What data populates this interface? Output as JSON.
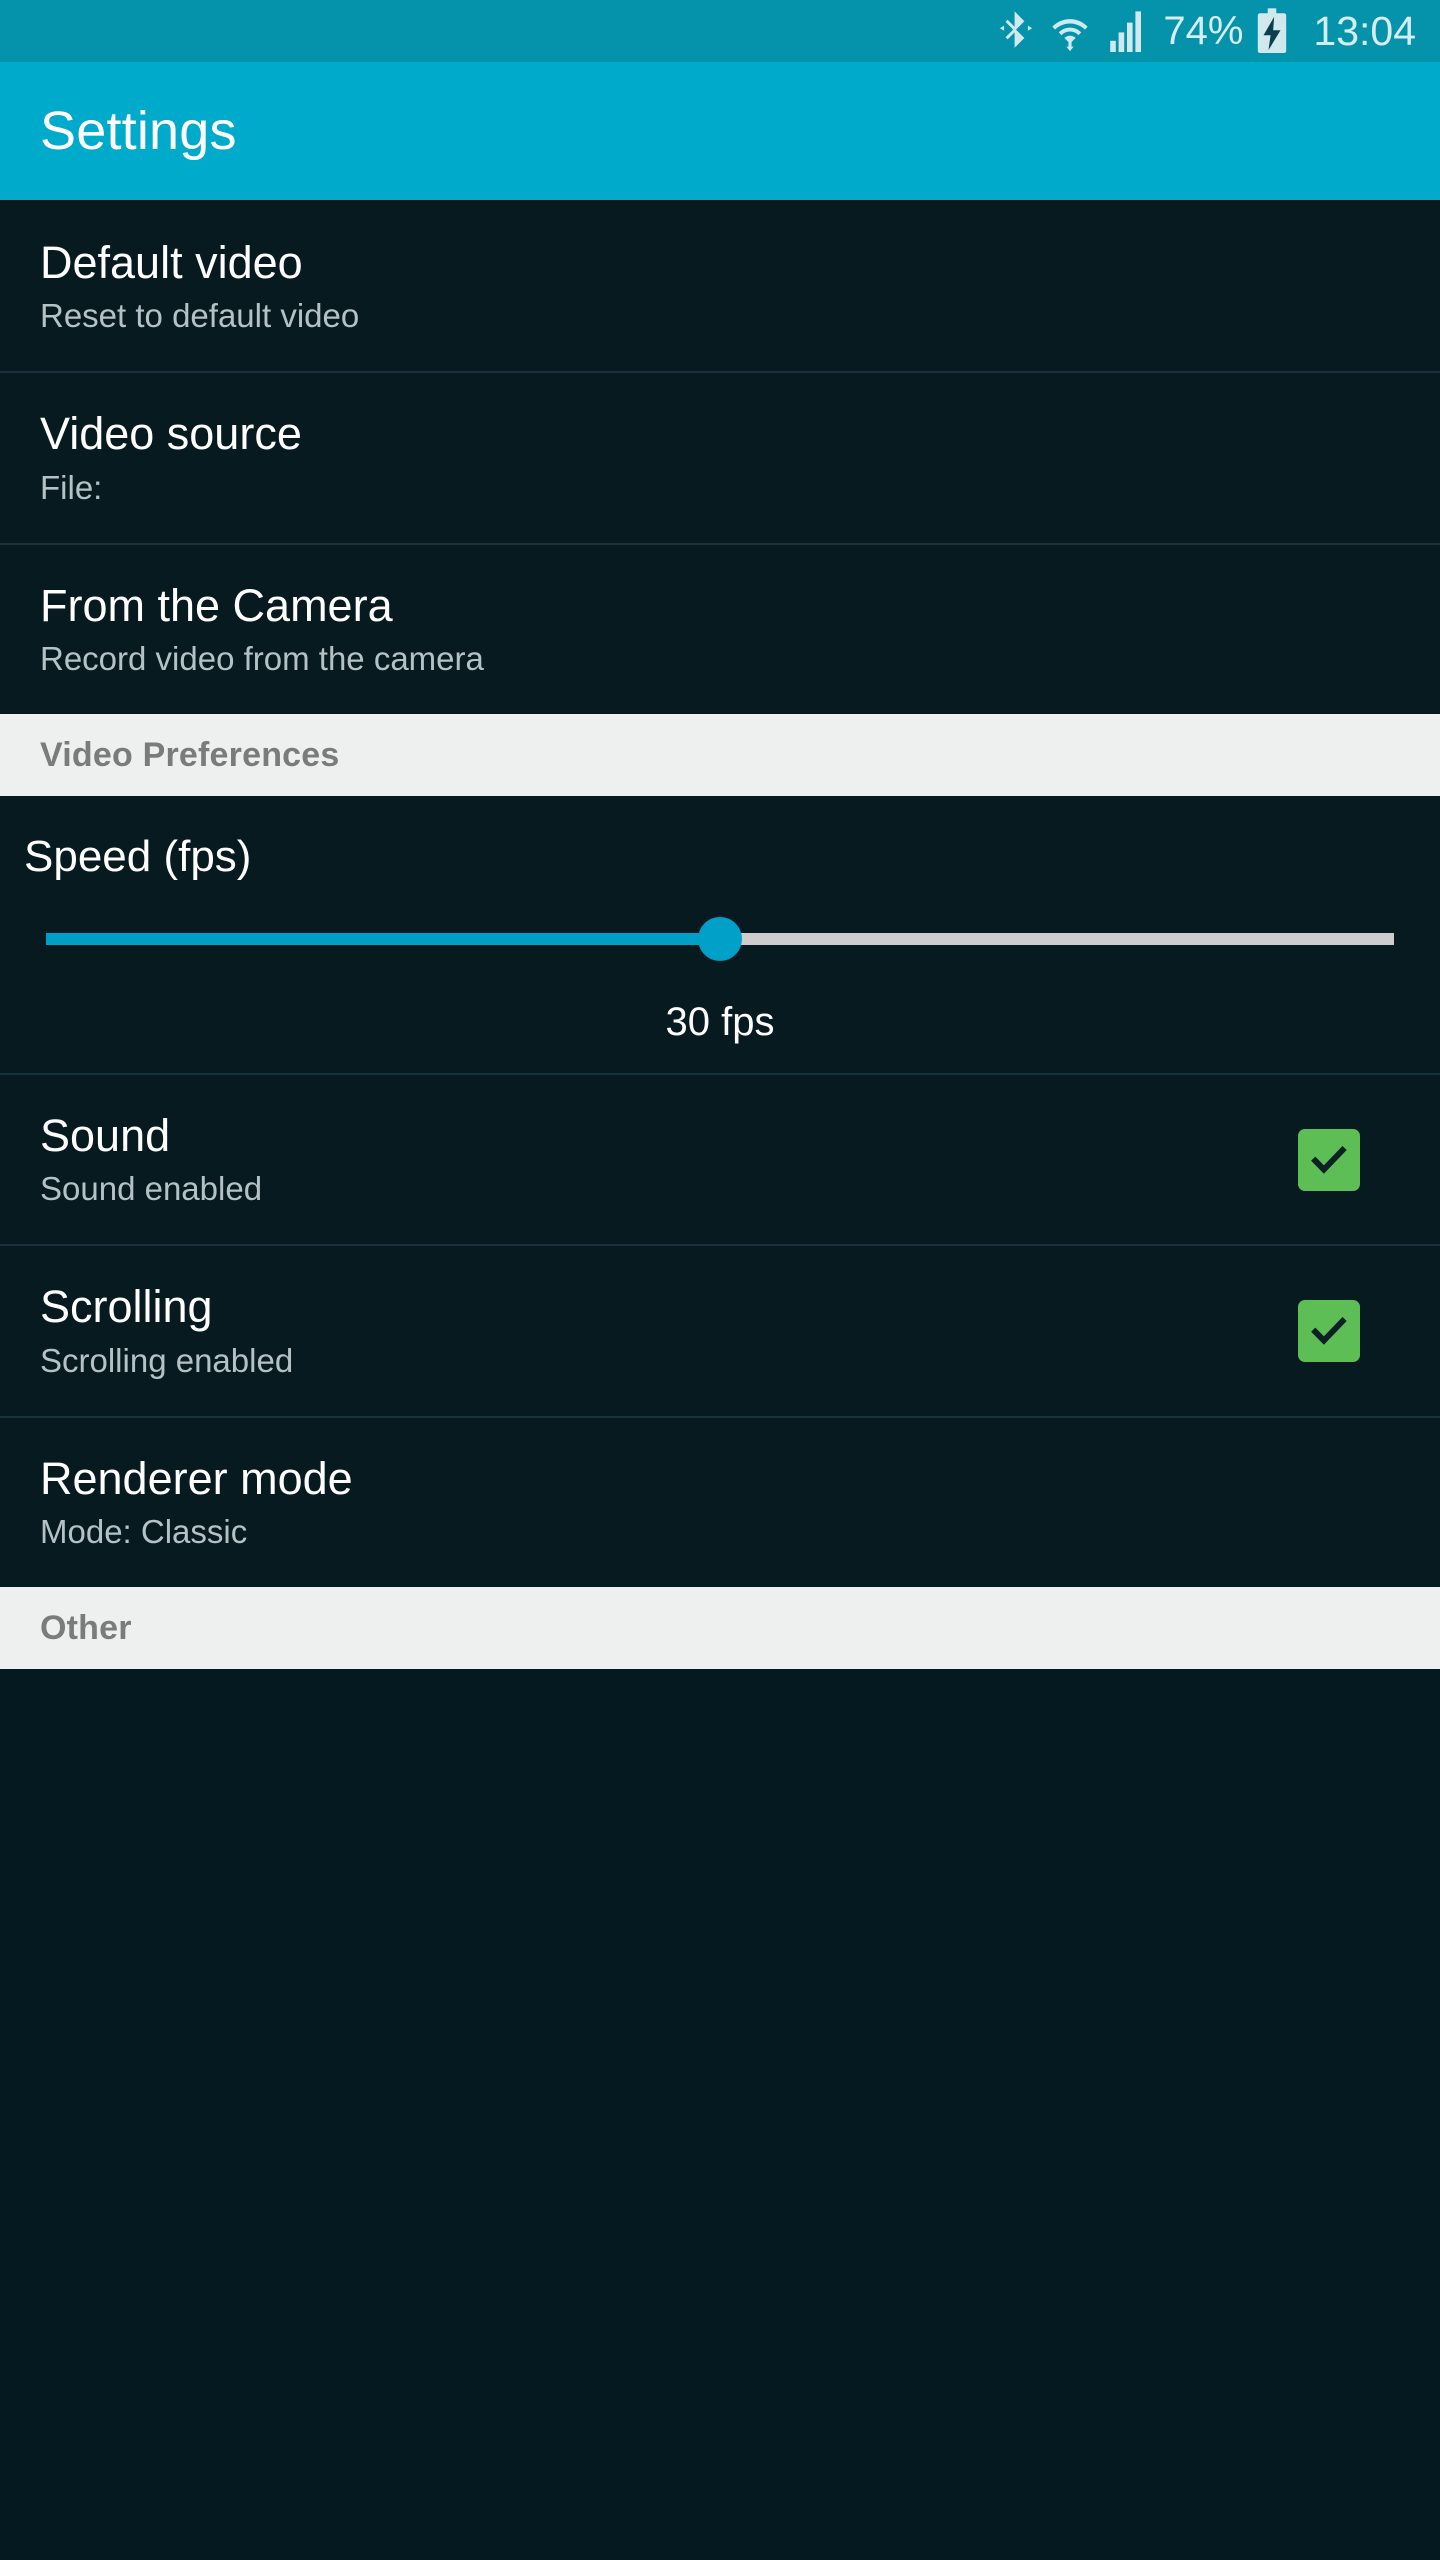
{
  "statusbar": {
    "icons": [
      "bluetooth-icon",
      "wifi-icon",
      "cellular-signal-icon",
      "battery-charging-icon"
    ],
    "battery_percent": "74%",
    "clock": "13:04",
    "background_color": "#0593ab",
    "foreground_color": "#d6eef2"
  },
  "actionbar": {
    "title": "Settings",
    "background_color": "#00aaca",
    "title_color": "#ffffff"
  },
  "theme": {
    "list_background": "#061a20",
    "divider": "#16323a",
    "primary_text": "#ffffff",
    "summary_text": "#b4c2c6",
    "section_background": "#eef0f0",
    "section_text": "#7b7b7b",
    "accent": "#00a0c9",
    "checkbox_checked": "#5cbe55",
    "seek_track": "#cdcdcd"
  },
  "preferences": [
    {
      "title": "Default video",
      "summary": "Reset to default video"
    },
    {
      "title": "Video source",
      "summary": "File:"
    },
    {
      "title": "From the Camera",
      "summary": "Record video from the camera"
    }
  ],
  "sections": [
    {
      "title": "Video Preferences"
    },
    {
      "title": "Other"
    }
  ],
  "seekbar": {
    "title": "Speed (fps)",
    "value_label": "30 fps",
    "value": 30,
    "min": 0,
    "max": 60,
    "percent": 50
  },
  "toggles": [
    {
      "title": "Sound",
      "summary": "Sound enabled",
      "checked": true,
      "icon": "checkbox-checked-icon"
    },
    {
      "title": "Scrolling",
      "summary": "Scrolling enabled",
      "checked": true,
      "icon": "checkbox-checked-icon"
    }
  ],
  "renderer": {
    "title": "Renderer mode",
    "summary": "Mode: Classic"
  }
}
